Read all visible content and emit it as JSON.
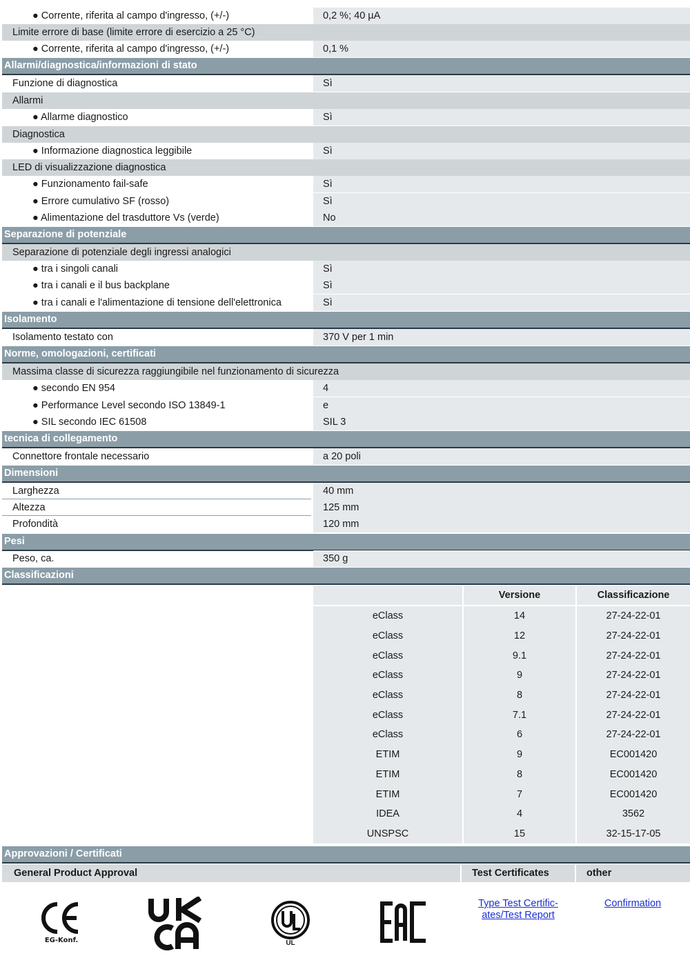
{
  "rows": {
    "r1": {
      "label": "● Corrente, riferita al campo d'ingresso, (+/-)",
      "value": "0,2 %; 40 µA"
    },
    "r2": {
      "label": "Limite errore di base (limite errore di esercizio a 25 °C)"
    },
    "r3": {
      "label": "● Corrente, riferita al campo d'ingresso, (+/-)",
      "value": "0,1 %"
    },
    "h1": {
      "label": "Allarmi/diagnostica/informazioni di stato"
    },
    "r4": {
      "label": "Funzione di diagnostica",
      "value": "Sì"
    },
    "r5": {
      "label": "Allarmi"
    },
    "r6": {
      "label": "● Allarme diagnostico",
      "value": "Sì"
    },
    "r7": {
      "label": "Diagnostica"
    },
    "r8": {
      "label": "● Informazione diagnostica leggibile",
      "value": "Sì"
    },
    "r9": {
      "label": "LED di visualizzazione diagnostica"
    },
    "r10": {
      "label": "● Funzionamento fail-safe",
      "value": "Sì"
    },
    "r11": {
      "label": "● Errore cumulativo SF (rosso)",
      "value": "Sì"
    },
    "r12": {
      "label": "● Alimentazione del trasduttore Vs (verde)",
      "value": "No"
    },
    "h2": {
      "label": "Separazione di potenziale"
    },
    "r13": {
      "label": "Separazione di potenziale degli ingressi analogici"
    },
    "r14": {
      "label": "● tra i singoli canali",
      "value": "Sì"
    },
    "r15": {
      "label": "● tra i canali e il bus backplane",
      "value": "Sì"
    },
    "r16": {
      "label": "● tra i canali e l'alimentazione di tensione dell'elettronica",
      "value": "Sì"
    },
    "h3": {
      "label": "Isolamento"
    },
    "r17": {
      "label": "Isolamento testato con",
      "value": "370 V per 1 min"
    },
    "h4": {
      "label": "Norme, omologazioni, certificati"
    },
    "r18": {
      "label": "Massima classe di sicurezza raggiungibile nel funzionamento di sicurezza"
    },
    "r19": {
      "label": "● secondo EN 954",
      "value": "4"
    },
    "r20": {
      "label": "● Performance Level secondo ISO 13849-1",
      "value": "e"
    },
    "r21": {
      "label": "● SIL secondo IEC 61508",
      "value": "SIL 3"
    },
    "h5": {
      "label": "tecnica di collegamento"
    },
    "r22": {
      "label": "Connettore frontale necessario",
      "value": "a 20 poli"
    },
    "h6": {
      "label": "Dimensioni"
    },
    "r23": {
      "label": "Larghezza",
      "value": "40 mm"
    },
    "r24": {
      "label": "Altezza",
      "value": "125 mm"
    },
    "r25": {
      "label": "Profondità",
      "value": "120 mm"
    },
    "h7": {
      "label": "Pesi"
    },
    "r26": {
      "label": "Peso, ca.",
      "value": "350 g"
    },
    "h8": {
      "label": "Classificazioni"
    },
    "h9": {
      "label": "Approvazioni / Certificati"
    }
  },
  "classification": {
    "headers": [
      "",
      "Versione",
      "Classificazione"
    ],
    "rows": [
      [
        "eClass",
        "14",
        "27-24-22-01"
      ],
      [
        "eClass",
        "12",
        "27-24-22-01"
      ],
      [
        "eClass",
        "9.1",
        "27-24-22-01"
      ],
      [
        "eClass",
        "9",
        "27-24-22-01"
      ],
      [
        "eClass",
        "8",
        "27-24-22-01"
      ],
      [
        "eClass",
        "7.1",
        "27-24-22-01"
      ],
      [
        "eClass",
        "6",
        "27-24-22-01"
      ],
      [
        "ETIM",
        "9",
        "EC001420"
      ],
      [
        "ETIM",
        "8",
        "EC001420"
      ],
      [
        "ETIM",
        "7",
        "EC001420"
      ],
      [
        "IDEA",
        "4",
        "3562"
      ],
      [
        "UNSPSC",
        "15",
        "32-15-17-05"
      ]
    ]
  },
  "approvals": {
    "general": "General Product Approval",
    "test": "Test Certificates",
    "other": "other",
    "logos": [
      {
        "icon": "ce-mark-icon",
        "caption": "EG-Konf."
      },
      {
        "icon": "ukca-mark-icon",
        "text": "UK CA"
      },
      {
        "icon": "ul-mark-icon",
        "caption": "UL"
      },
      {
        "icon": "eac-mark-icon",
        "text": "EAC"
      }
    ],
    "test_link": "Type Test Certific-ates/Test Report",
    "other_link": "Confirmation"
  }
}
